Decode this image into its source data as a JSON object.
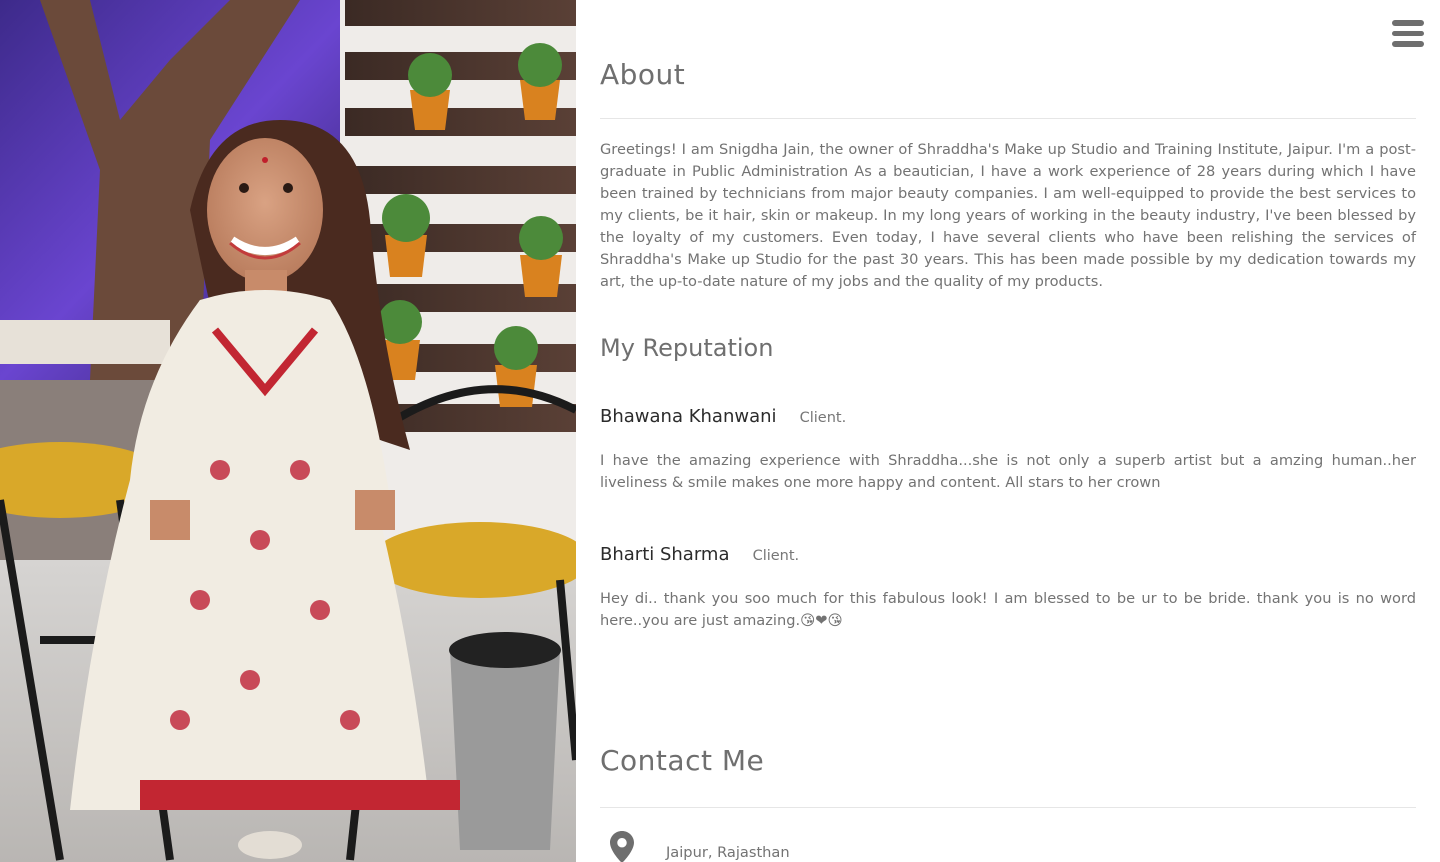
{
  "menu": {
    "icon": "hamburger-menu-icon"
  },
  "about": {
    "title": "About",
    "text": "Greetings! I am Snigdha Jain, the owner of Shraddha's Make up Studio and Training Institute, Jaipur. I'm a post-graduate in Public Administration As a beautician, I have a work experience of 28 years during which I have been trained by technicians from major beauty companies. I am well-equipped to provide the best services to my clients, be it hair, skin or makeup. In my long years of working in the beauty industry, I've been blessed by the loyalty of my customers. Even today, I have several clients who have been relishing the services of Shraddha's Make up Studio for the past 30 years. This has been made possible by my dedication towards my art, the up-to-date nature of my jobs and the quality of my products."
  },
  "reputation": {
    "title": "My Reputation",
    "reviews": [
      {
        "name": "Bhawana Khanwani",
        "role": "Client.",
        "text": "I have the amazing experience with Shraddha...she is not only a superb artist but a amzing human..her liveliness & smile makes one more happy and content. All stars to her crown"
      },
      {
        "name": "Bharti Sharma",
        "role": "Client.",
        "text": "Hey di.. thank you soo much for this fabulous look! I am blessed to be ur to be bride. thank you is no word here..you are just amazing.😘❤😘"
      }
    ]
  },
  "contact": {
    "title": "Contact Me",
    "location_icon": "map-marker-icon",
    "location": "Jaipur, Rajasthan"
  },
  "colors": {
    "text": "#6f6f6f",
    "name": "#2b2b2b",
    "divider": "#e6e6e6",
    "menu": "#6e6e6e"
  }
}
